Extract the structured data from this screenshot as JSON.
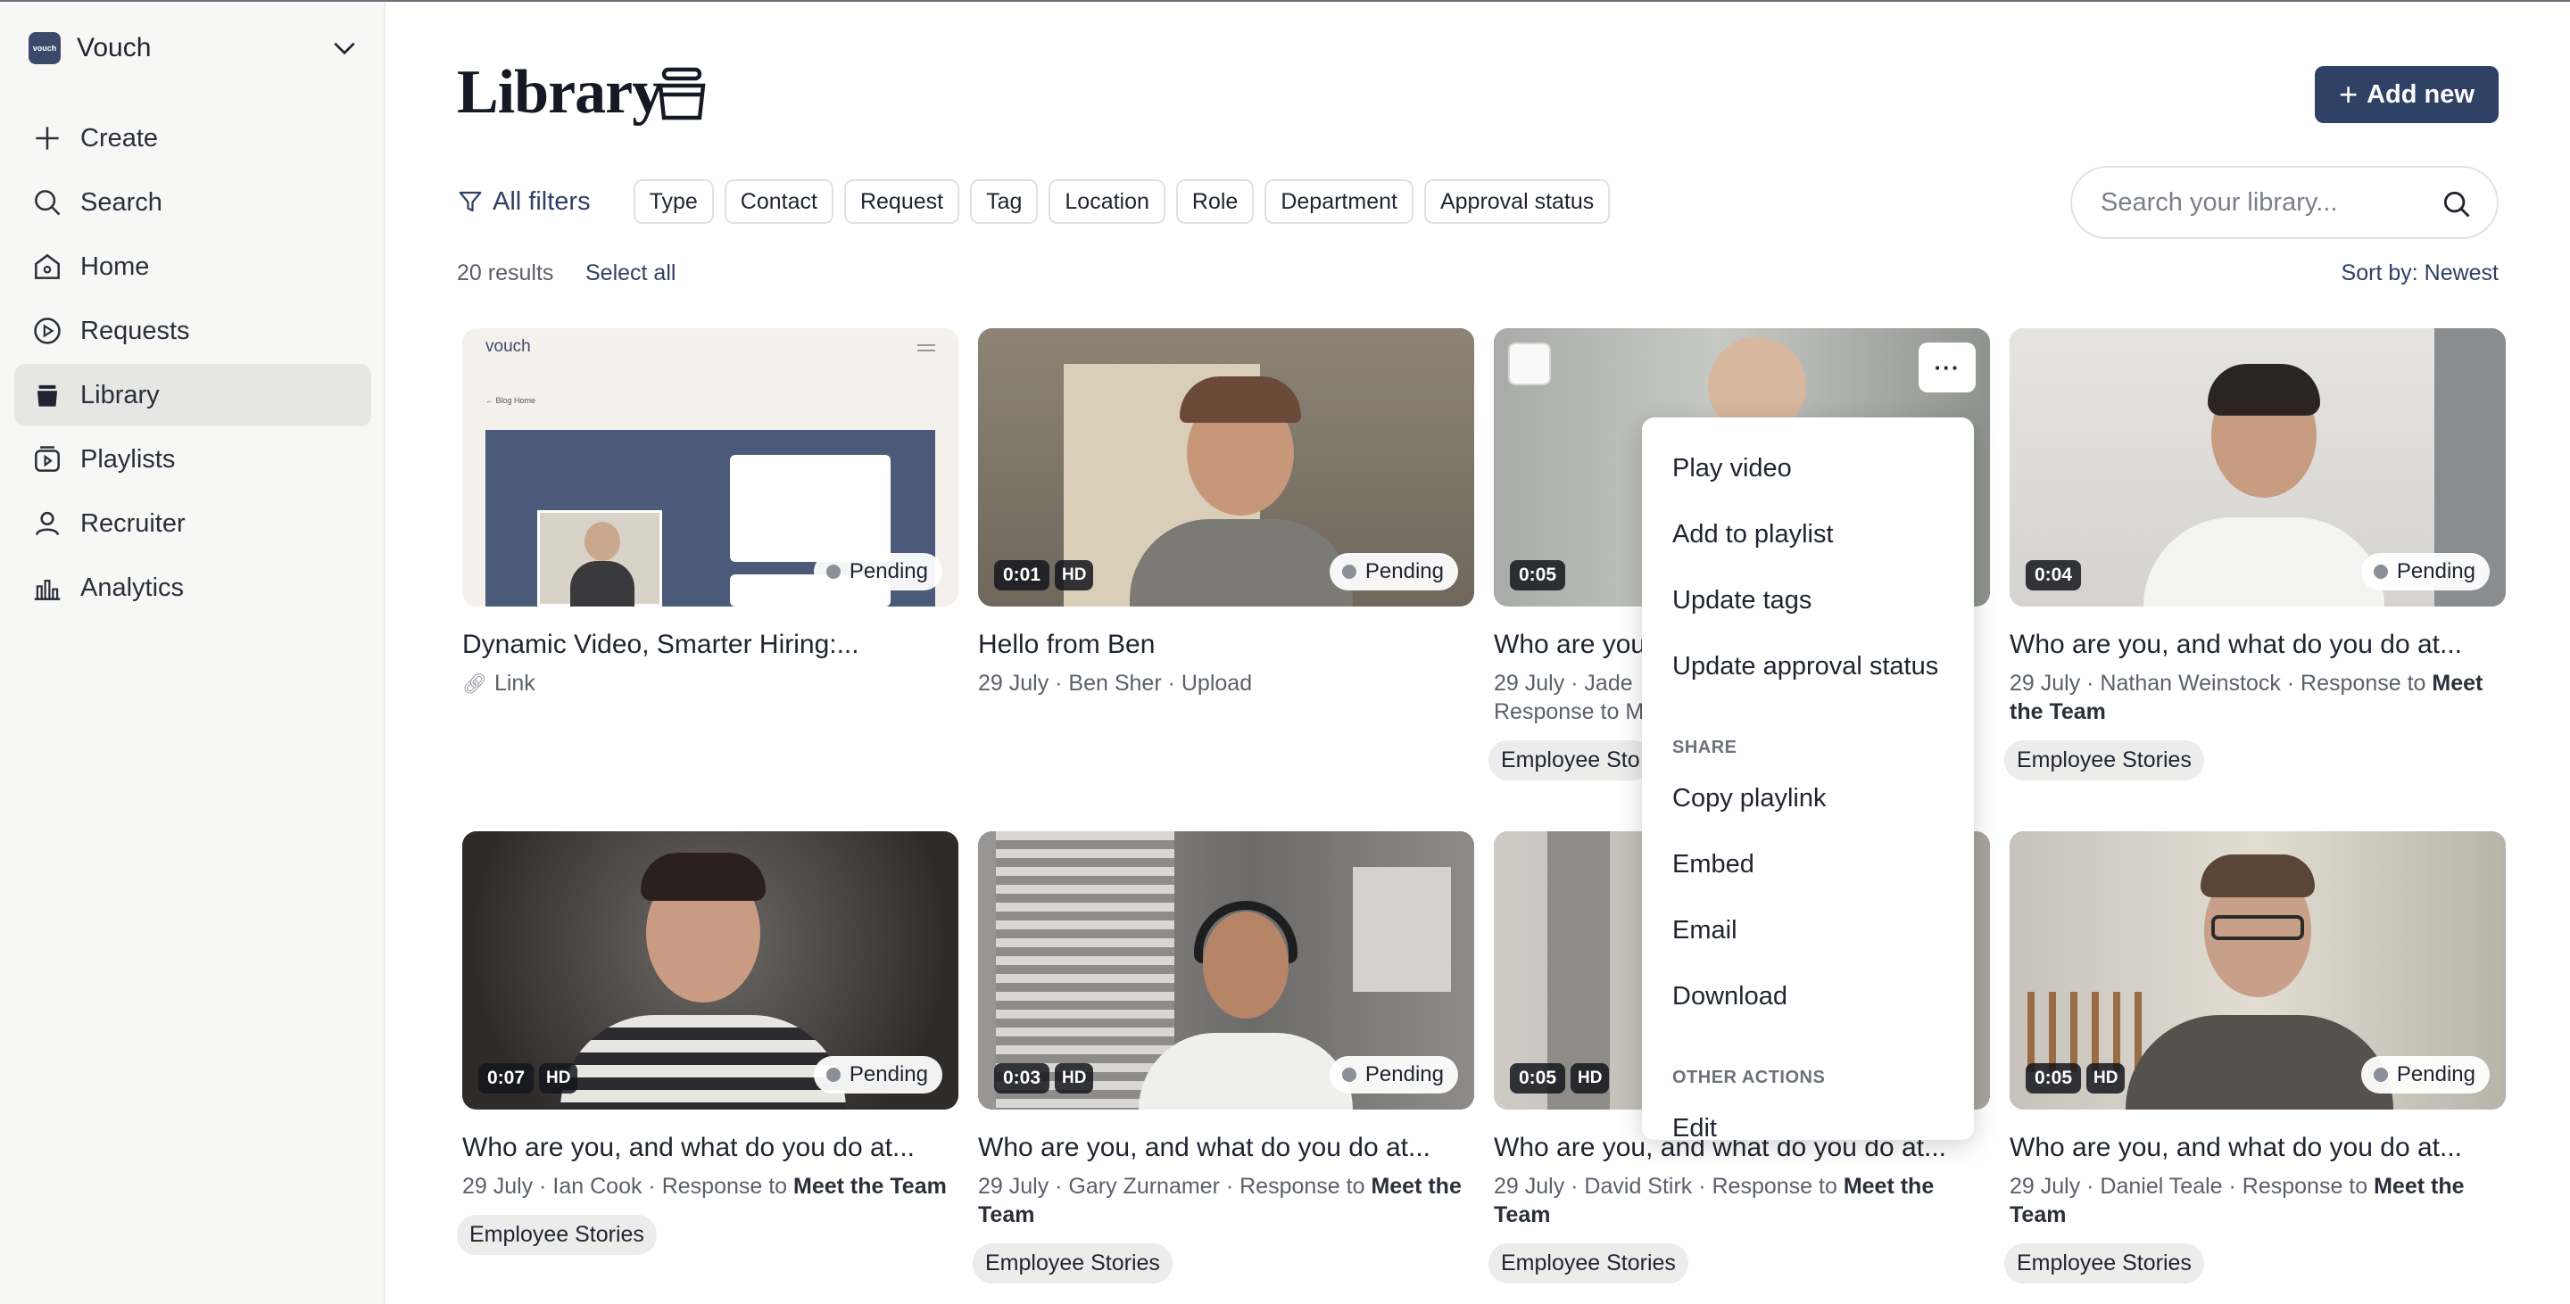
{
  "brand": {
    "name": "Vouch",
    "logo_text": "vouch"
  },
  "sidebar": {
    "items": [
      {
        "label": "Create",
        "icon": "plus-icon"
      },
      {
        "label": "Search",
        "icon": "search-icon"
      },
      {
        "label": "Home",
        "icon": "home-icon"
      },
      {
        "label": "Requests",
        "icon": "play-circle-icon"
      },
      {
        "label": "Library",
        "icon": "library-icon",
        "active": true
      },
      {
        "label": "Playlists",
        "icon": "playlist-icon"
      },
      {
        "label": "Recruiter",
        "icon": "user-icon"
      },
      {
        "label": "Analytics",
        "icon": "analytics-icon"
      }
    ]
  },
  "header": {
    "title": "Library",
    "add_new_label": "Add new"
  },
  "filters": {
    "all_label": "All filters",
    "chips": [
      "Type",
      "Contact",
      "Request",
      "Tag",
      "Location",
      "Role",
      "Department",
      "Approval status"
    ]
  },
  "search": {
    "placeholder": "Search your library..."
  },
  "results": {
    "count_label": "20 results",
    "select_all": "Select all",
    "sort_label": "Sort by: Newest"
  },
  "cards": [
    {
      "title": "Dynamic Video, Smarter Hiring:...",
      "meta": "Link",
      "duration": "",
      "hd": false,
      "status": "Pending",
      "tag": ""
    },
    {
      "title": "Hello from Ben",
      "meta": "29 July · Ben Sher · Upload",
      "duration": "0:01",
      "hd": true,
      "status": "Pending",
      "tag": ""
    },
    {
      "title": "Who are you",
      "meta_line1": "29 July · Jade",
      "meta_line2": "Response to M",
      "duration": "0:05",
      "hd": false,
      "status": "",
      "tag": "Employee Sto"
    },
    {
      "title": "Who are you, and what do you do at...",
      "meta_prefix": "29 July · Nathan Weinstock · Response to ",
      "meta_bold": "Meet the Team",
      "duration": "0:04",
      "hd": false,
      "status": "Pending",
      "tag": "Employee Stories"
    },
    {
      "title": "Who are you, and what do you do at...",
      "meta_prefix": "29 July · Ian Cook · Response to ",
      "meta_bold": "Meet the Team",
      "duration": "0:07",
      "hd": true,
      "status": "Pending",
      "tag": "Employee Stories"
    },
    {
      "title": "Who are you, and what do you do at...",
      "meta_prefix": "29 July · Gary Zurnamer · Response to ",
      "meta_bold": "Meet the Team",
      "duration": "0:03",
      "hd": true,
      "status": "Pending",
      "tag": "Employee Stories"
    },
    {
      "title": "Who are you, and what do you do at...",
      "meta_prefix": "29 July · David Stirk · Response to ",
      "meta_bold": "Meet the Team",
      "duration": "0:05",
      "hd": true,
      "status": "",
      "tag": "Employee Stories"
    },
    {
      "title": "Who are you, and what do you do at...",
      "meta_prefix": "29 July · Daniel Teale · Response to ",
      "meta_bold": "Meet the Team",
      "duration": "0:05",
      "hd": true,
      "status": "Pending",
      "tag": "Employee Stories"
    }
  ],
  "thumbnail_text": {
    "brand": "vouch",
    "back_link": "← Blog Home"
  },
  "context_menu": {
    "more_label": "···",
    "items": [
      "Play video",
      "Add to playlist",
      "Update tags",
      "Update approval status"
    ],
    "share_heading": "SHARE",
    "share_items": [
      "Copy playlink",
      "Embed",
      "Email",
      "Download"
    ],
    "other_heading": "OTHER ACTIONS",
    "other_items": [
      "Edit"
    ]
  },
  "colors": {
    "accent": "#2f4164",
    "sidebar_bg": "#f7f7f6",
    "active_bg": "#e6e6e4"
  }
}
